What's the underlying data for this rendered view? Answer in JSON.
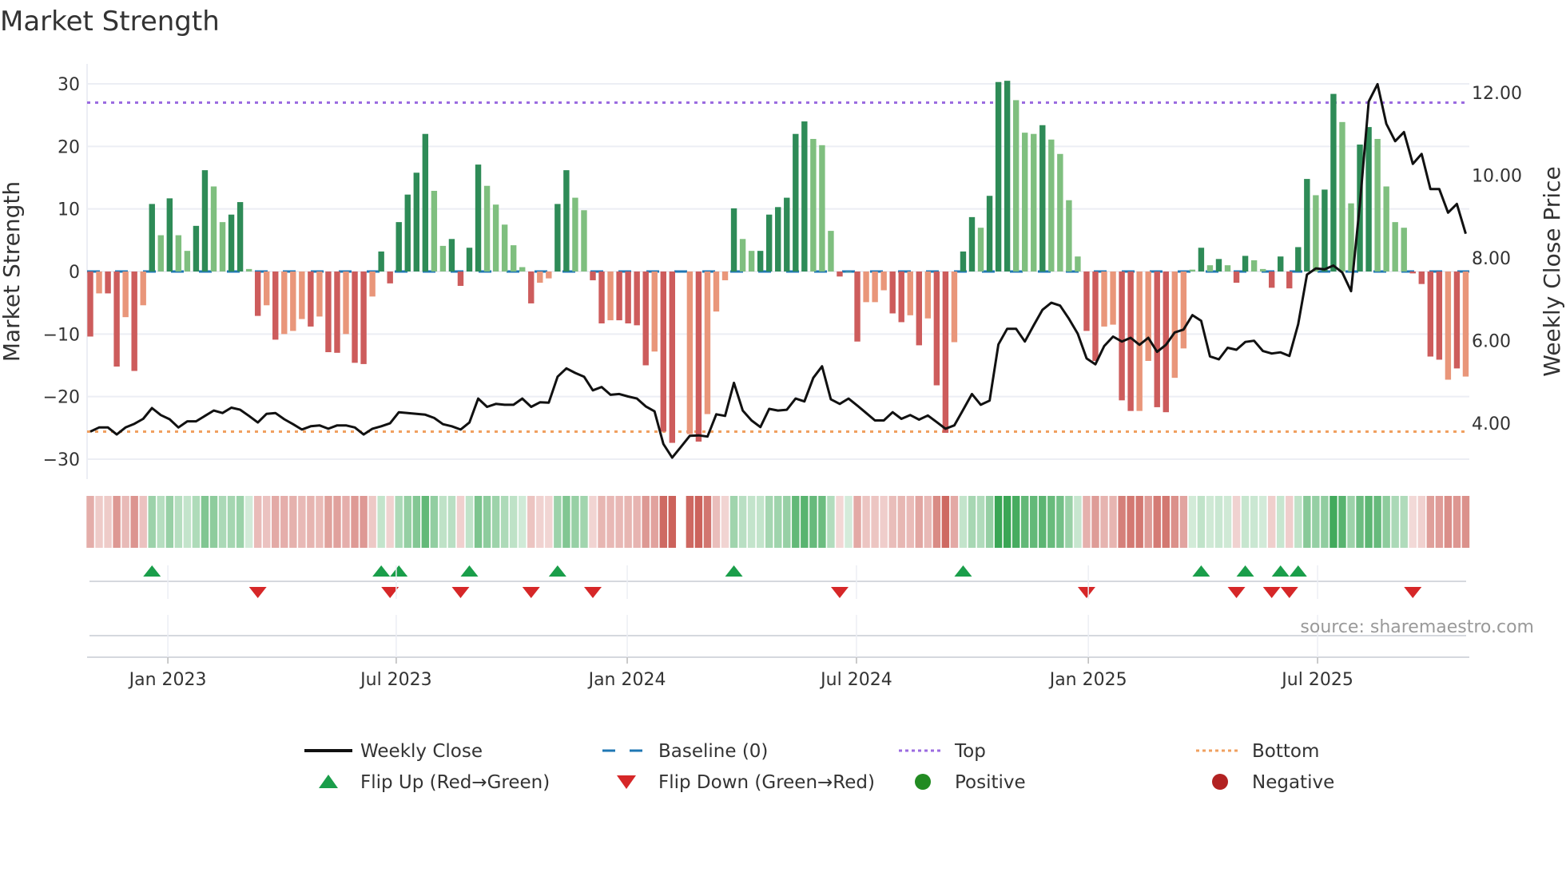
{
  "chart_data": {
    "type": "bar+line",
    "title": "Market Strength",
    "ylabel": "Market Strength",
    "y2label": "Weekly Close Price",
    "ylim": [
      -33.2,
      33.2
    ],
    "y2lim": [
      2.65,
      12.7
    ],
    "yticks": [
      -30,
      -20,
      -10,
      0,
      10,
      20,
      30
    ],
    "ytick_labels": [
      "−30",
      "−20",
      "−10",
      "0",
      "10",
      "20",
      "30"
    ],
    "y2ticks": [
      4,
      6,
      8,
      10,
      12
    ],
    "y2tick_labels": [
      "4.00",
      "6.00",
      "8.00",
      "10.00",
      "12.00"
    ],
    "xticks": [
      {
        "label": "Jan 2023",
        "week": 8.8
      },
      {
        "label": "Jul 2023",
        "week": 34.7
      },
      {
        "label": "Jan 2024",
        "week": 60.9
      },
      {
        "label": "Jul 2024",
        "week": 86.9
      },
      {
        "label": "Jan 2025",
        "week": 113.2
      },
      {
        "label": "Jul 2025",
        "week": 139.2
      }
    ],
    "top_level": 27,
    "bottom_level": -25.6,
    "grid": true,
    "strength": [
      -10.4,
      -3.5,
      -3.5,
      -15.2,
      -7.3,
      -15.9,
      -5.4,
      10.8,
      5.8,
      11.7,
      5.8,
      3.3,
      7.3,
      16.2,
      13.6,
      7.9,
      9.1,
      11.1,
      0.4,
      -7.1,
      -5.4,
      -10.9,
      -10.0,
      -9.5,
      -7.6,
      -8.8,
      -7.2,
      -12.9,
      -13.0,
      -10.0,
      -14.6,
      -14.8,
      -4.0,
      3.2,
      -1.9,
      7.9,
      12.3,
      15.8,
      22.0,
      12.9,
      4.1,
      5.2,
      -2.3,
      3.8,
      17.1,
      13.7,
      10.7,
      7.5,
      4.2,
      0.7,
      -5.1,
      -1.8,
      -1.1,
      10.8,
      16.2,
      11.8,
      9.8,
      -1.4,
      -8.3,
      -7.8,
      -7.8,
      -8.3,
      -8.6,
      -15.0,
      -12.8,
      -25.6,
      -27.4,
      null,
      -26.0,
      -27.2,
      -22.8,
      -6.4,
      -1.4,
      10.1,
      5.2,
      3.3,
      3.3,
      9.1,
      10.3,
      11.8,
      22.0,
      24.0,
      21.2,
      20.2,
      6.5,
      -0.8,
      0,
      -11.2,
      -4.9,
      -4.9,
      -3.0,
      -6.7,
      -8.1,
      -7.0,
      -11.8,
      -7.5,
      -18.2,
      -25.8,
      -11.3,
      3.2,
      8.7,
      7.0,
      12.1,
      30.3,
      30.5,
      27.4,
      22.2,
      22.0,
      23.4,
      21.1,
      18.8,
      11.4,
      2.4,
      -9.5,
      -14.3,
      -8.8,
      -8.5,
      -20.6,
      -22.3,
      -22.3,
      -14.3,
      -21.7,
      -22.5,
      -17.0,
      -12.3,
      0.3,
      3.8,
      1.0,
      2.0,
      1.0,
      -1.8,
      2.5,
      1.8,
      0.4,
      -2.6,
      2.4,
      -2.7,
      3.9,
      14.8,
      12.2,
      13.1,
      28.4,
      23.9,
      10.9,
      20.3,
      23.1,
      21.2,
      13.6,
      7.9,
      7.0,
      -0.3,
      -2.0,
      -13.6,
      -14.1,
      -17.3,
      -15.5,
      -16.8
    ],
    "strong": [
      1,
      0,
      1,
      1,
      0,
      1,
      0,
      1,
      0,
      1,
      0,
      0,
      1,
      1,
      0,
      0,
      1,
      1,
      0,
      1,
      0,
      1,
      0,
      0,
      0,
      1,
      0,
      1,
      1,
      0,
      1,
      1,
      0,
      1,
      1,
      1,
      1,
      1,
      1,
      0,
      0,
      1,
      1,
      1,
      1,
      0,
      0,
      0,
      0,
      0,
      1,
      0,
      0,
      1,
      1,
      0,
      0,
      1,
      1,
      0,
      1,
      1,
      1,
      1,
      0,
      1,
      1,
      0,
      0,
      1,
      0,
      0,
      0,
      1,
      0,
      0,
      1,
      1,
      1,
      1,
      1,
      1,
      0,
      0,
      0,
      1,
      0,
      1,
      0,
      0,
      0,
      1,
      1,
      0,
      1,
      0,
      1,
      1,
      0,
      1,
      1,
      0,
      1,
      1,
      1,
      0,
      0,
      0,
      1,
      0,
      0,
      0,
      0,
      1,
      1,
      0,
      0,
      1,
      1,
      0,
      0,
      1,
      1,
      0,
      0,
      0,
      1,
      0,
      1,
      0,
      1,
      1,
      0,
      0,
      1,
      1,
      1,
      1,
      1,
      0,
      1,
      1,
      0,
      0,
      1,
      1,
      0,
      0,
      0,
      0,
      1,
      1,
      1,
      1,
      0,
      1
    ],
    "weekly_close": [
      3.8,
      3.9,
      3.9,
      3.73,
      3.9,
      3.99,
      4.11,
      4.37,
      4.2,
      4.1,
      3.9,
      4.05,
      4.05,
      4.18,
      4.31,
      4.25,
      4.38,
      4.33,
      4.18,
      4.02,
      4.23,
      4.25,
      4.1,
      3.98,
      3.85,
      3.93,
      3.95,
      3.87,
      3.95,
      3.95,
      3.9,
      3.73,
      3.87,
      3.93,
      4.0,
      4.27,
      4.25,
      4.23,
      4.21,
      4.13,
      3.98,
      3.93,
      3.85,
      4.02,
      4.6,
      4.4,
      4.47,
      4.45,
      4.45,
      4.6,
      4.4,
      4.51,
      4.5,
      5.13,
      5.33,
      5.22,
      5.13,
      4.8,
      4.88,
      4.69,
      4.71,
      4.65,
      4.6,
      4.41,
      4.29,
      3.5,
      3.17,
      3.43,
      3.7,
      3.71,
      3.68,
      4.22,
      4.18,
      4.98,
      4.31,
      4.07,
      3.91,
      4.35,
      4.31,
      4.33,
      4.6,
      4.53,
      5.1,
      5.38,
      4.58,
      4.47,
      4.6,
      4.43,
      4.25,
      4.07,
      4.07,
      4.27,
      4.11,
      4.2,
      4.09,
      4.19,
      4.03,
      3.87,
      3.95,
      4.33,
      4.71,
      4.45,
      4.55,
      5.91,
      6.29,
      6.29,
      5.98,
      6.37,
      6.75,
      6.92,
      6.85,
      6.53,
      6.17,
      5.57,
      5.43,
      5.87,
      6.1,
      5.98,
      6.07,
      5.9,
      6.07,
      5.73,
      5.9,
      6.2,
      6.27,
      6.62,
      6.48,
      5.62,
      5.55,
      5.83,
      5.78,
      5.97,
      6.0,
      5.75,
      5.69,
      5.72,
      5.63,
      6.4,
      7.6,
      7.75,
      7.73,
      7.82,
      7.65,
      7.2,
      9.3,
      11.79,
      12.21,
      11.25,
      10.83,
      11.05,
      10.28,
      10.52,
      9.67,
      9.67,
      9.1,
      9.31,
      8.59
    ],
    "flip_up_weeks": [
      8,
      34,
      36,
      44,
      54,
      74,
      100,
      127,
      132,
      136,
      138
    ],
    "flip_down_weeks": [
      20,
      35,
      43,
      51,
      58,
      86,
      114,
      131,
      135,
      137,
      151
    ],
    "legend": [
      {
        "label": "Weekly Close",
        "marker": "line"
      },
      {
        "label": "Baseline (0)",
        "marker": "dash"
      },
      {
        "label": "Top",
        "marker": "dot-purple"
      },
      {
        "label": "Bottom",
        "marker": "dot-orange"
      },
      {
        "label": "Flip Up (Red→Green)",
        "marker": "triangle-up"
      },
      {
        "label": "Flip Down (Green→Red)",
        "marker": "triangle-down"
      },
      {
        "label": "Positive",
        "marker": "circle-green"
      },
      {
        "label": "Negative",
        "marker": "circle-red"
      }
    ],
    "legend_position": "bottom",
    "source": "source: sharemaestro.com"
  },
  "colors": {
    "strong_pos": "#2e8b57",
    "weak_pos": "#7fbf7f",
    "strong_neg": "#cd5c5c",
    "weak_neg": "#e9967a",
    "baseline": "#1f77b4",
    "top": "#9b6be0",
    "bottom": "#f0a060",
    "close": "#111111",
    "flip_up": "#1a9e4a",
    "flip_down": "#d62728",
    "positive": "#228b22",
    "negative": "#b22222",
    "strip_pos": "#3aa655",
    "strip_neg": "#c8574f",
    "grid": "#eceef4"
  }
}
